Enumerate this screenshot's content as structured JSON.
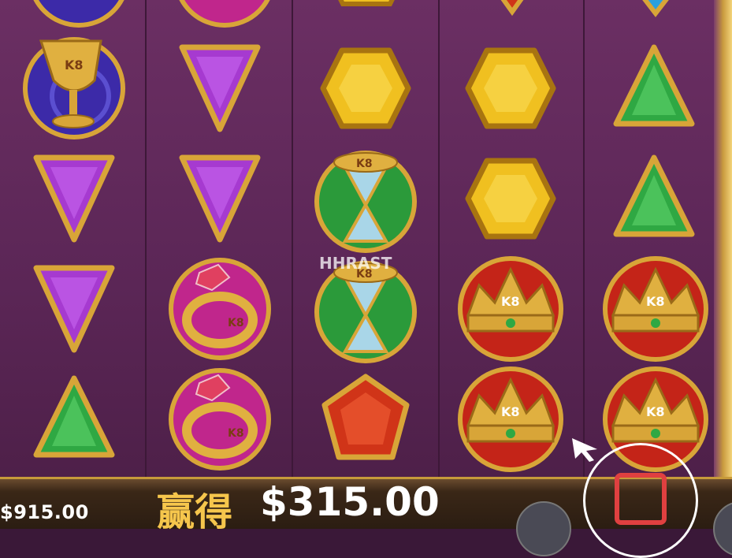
{
  "game": {
    "balance": "$915.00",
    "win_label": "赢得",
    "win_amount": "$315.00",
    "watermark": "HHRAST"
  },
  "reels": [
    [
      "chalice",
      "purple-gem",
      "purple-gem",
      "green-gem"
    ],
    [
      "purple-gem",
      "purple-gem",
      "ring",
      "ring"
    ],
    [
      "yellow-gem",
      "hourglass",
      "hourglass",
      "red-gem"
    ],
    [
      "yellow-gem",
      "yellow-gem",
      "crown",
      "crown"
    ],
    [
      "green-gem",
      "green-gem",
      "crown",
      "crown"
    ]
  ],
  "icons": {
    "spin": "stop-square-icon",
    "cursor": "arrow-cursor-icon"
  },
  "colors": {
    "purple_gem": "#a63ad0",
    "green_gem": "#2fa843",
    "yellow_gem": "#f0c020",
    "red_gem": "#d03418",
    "gold": "#d8a538",
    "win_label": "#f6c64c"
  }
}
